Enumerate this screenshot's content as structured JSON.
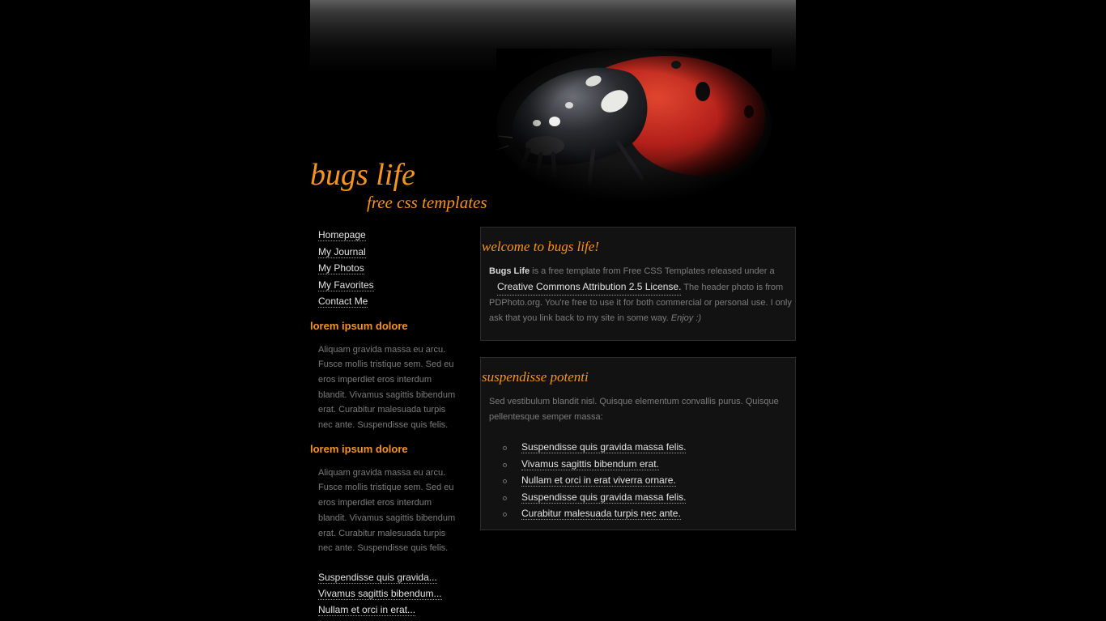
{
  "header": {
    "title": "bugs life",
    "subtitle": "free css templates"
  },
  "sidebar": {
    "menu": [
      {
        "label": "Homepage"
      },
      {
        "label": "My Journal"
      },
      {
        "label": "My Photos"
      },
      {
        "label": "My Favorites"
      },
      {
        "label": "Contact Me"
      }
    ],
    "sections": [
      {
        "heading": "lorem ipsum dolore",
        "text": "Aliquam gravida massa eu arcu. Fusce mollis tristique sem. Sed eu eros imperdiet eros interdum blandit. Vivamus sagittis bibendum erat. Curabitur malesuada turpis nec ante. Suspendisse quis felis."
      },
      {
        "heading": "lorem ipsum dolore",
        "text": "Aliquam gravida massa eu arcu. Fusce mollis tristique sem. Sed eu eros imperdiet eros interdum blandit. Vivamus sagittis bibendum erat. Curabitur malesuada turpis nec ante. Suspendisse quis felis."
      }
    ],
    "links": [
      {
        "label": "Suspendisse quis gravida..."
      },
      {
        "label": "Vivamus sagittis bibendum..."
      },
      {
        "label": "Nullam et orci in erat..."
      }
    ]
  },
  "welcome": {
    "heading": "welcome to bugs life!",
    "bold_name": "Bugs Life",
    "text_before_link": " is a free template from Free CSS Templates released under a",
    "link_label": "Creative Commons Attribution 2.5 License.",
    "text_after_link": " The header photo is from PDPhoto.org. You're free to use it for both commercial or personal use. I only ask that you link back to my site in some way. ",
    "closing": "Enjoy :)"
  },
  "suspendisse": {
    "heading": "suspendisse potenti",
    "text": "Sed vestibulum blandit nisl. Quisque elementum convallis purus. Quisque pellentesque semper massa:",
    "items": [
      {
        "label": "Suspendisse quis gravida massa felis."
      },
      {
        "label": "Vivamus sagittis bibendum erat."
      },
      {
        "label": "Nullam et orci in erat viverra ornare."
      },
      {
        "label": "Suspendisse quis gravida massa felis."
      },
      {
        "label": "Curabitur malesuada turpis nec ante."
      }
    ]
  },
  "colors": {
    "background": "#000000",
    "accent": "#f7941e",
    "link": "#e4e4e4",
    "body_text": "#7c7c7c",
    "box_background": "#121212",
    "box_border": "#2c2c2c"
  },
  "icons": {
    "header_photo": "ladybug-photo",
    "list_bullet": "circle-bullet-icon"
  }
}
